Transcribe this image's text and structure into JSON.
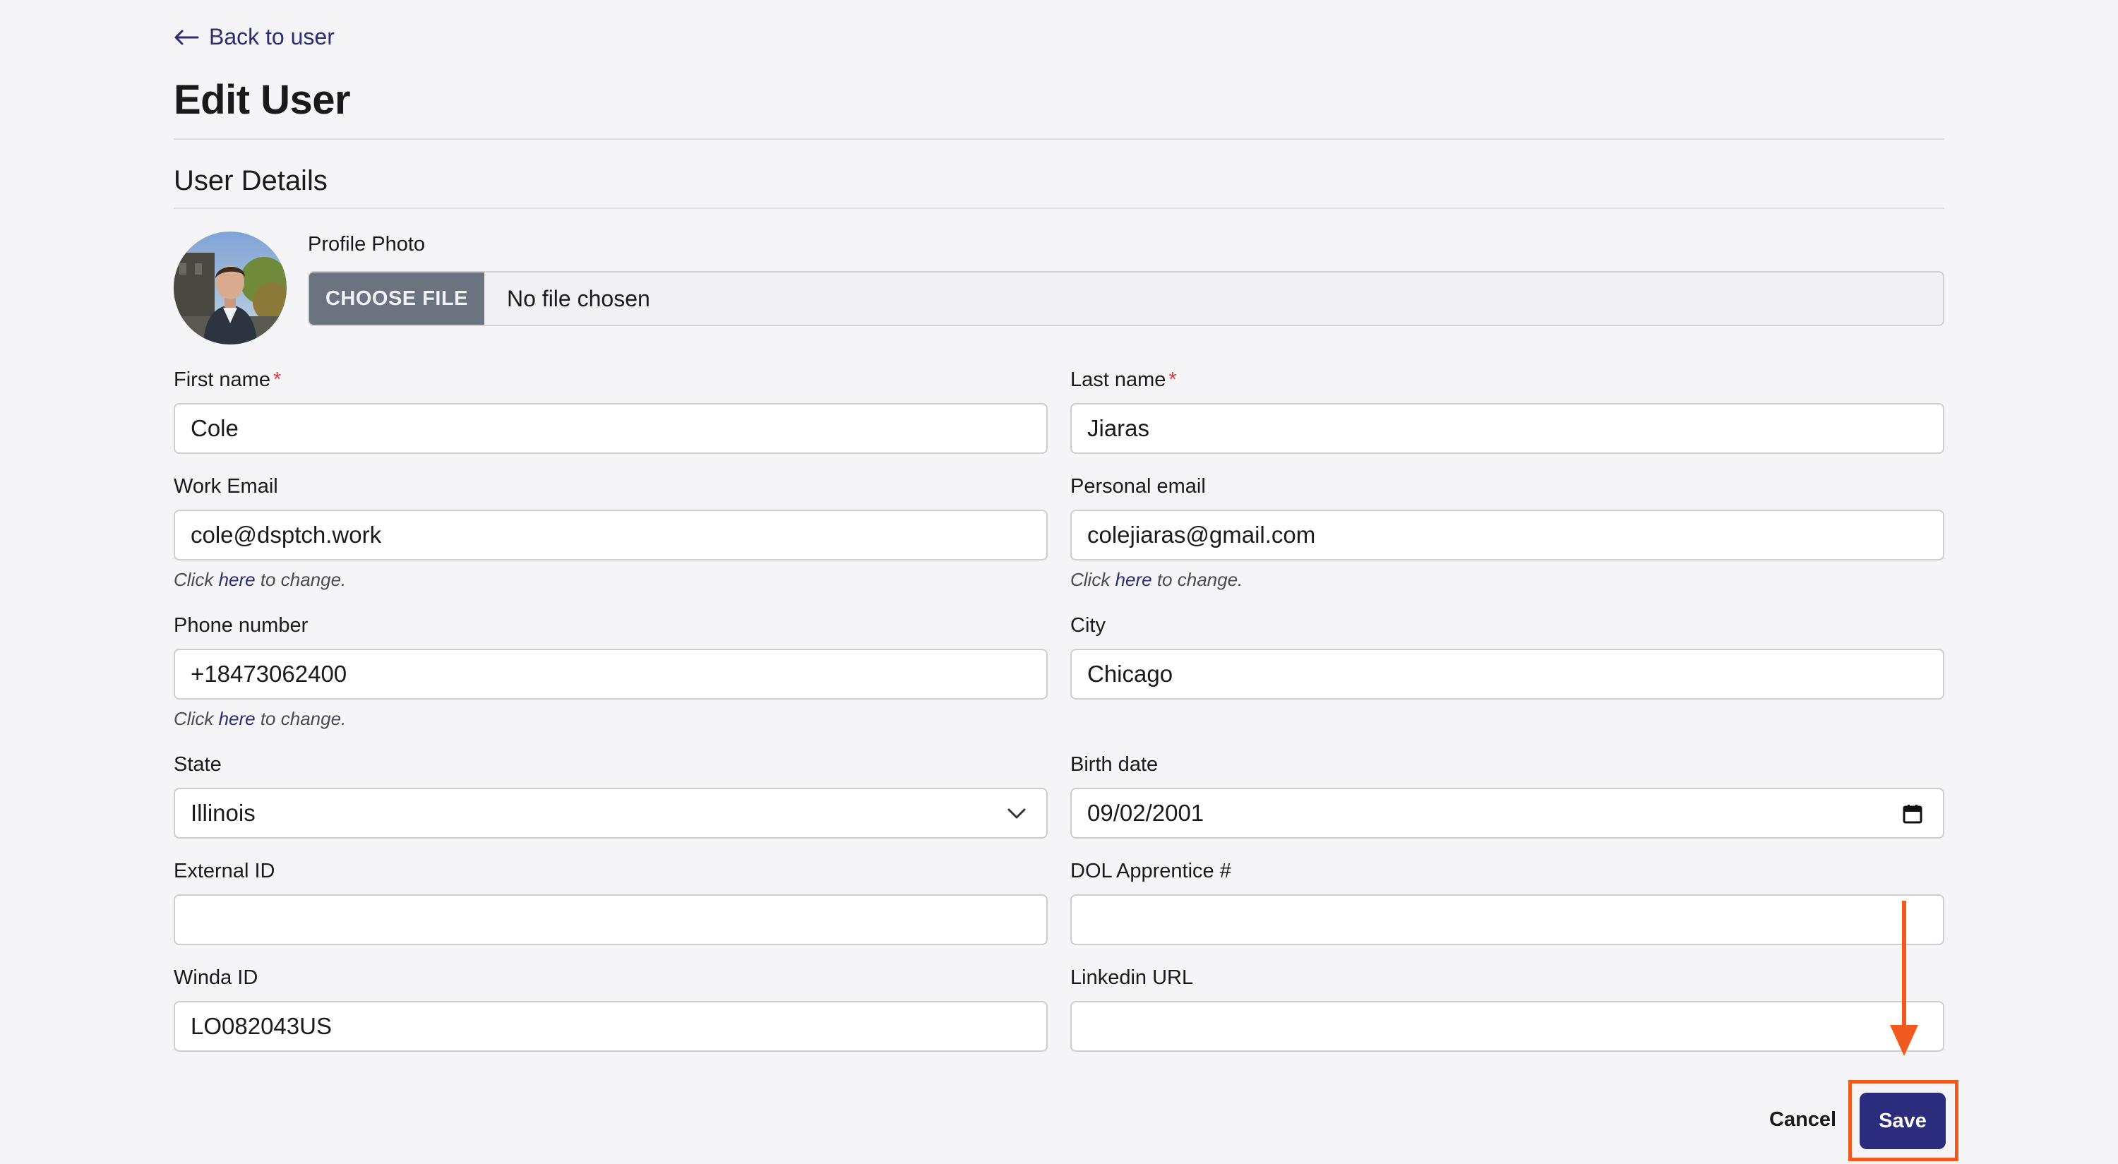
{
  "nav": {
    "back_label": "Back to user"
  },
  "page": {
    "title": "Edit User",
    "section_title": "User Details"
  },
  "profile_photo": {
    "label": "Profile Photo",
    "choose_button": "CHOOSE FILE",
    "status": "No file chosen"
  },
  "fields": {
    "first_name": {
      "label": "First name",
      "required_mark": "*",
      "value": "Cole"
    },
    "last_name": {
      "label": "Last name",
      "required_mark": "*",
      "value": "Jiaras"
    },
    "work_email": {
      "label": "Work Email",
      "value": "cole@dsptch.work"
    },
    "personal_email": {
      "label": "Personal email",
      "value": "colejiaras@gmail.com"
    },
    "phone": {
      "label": "Phone number",
      "value": "+18473062400"
    },
    "city": {
      "label": "City",
      "value": "Chicago"
    },
    "state": {
      "label": "State",
      "value": "Illinois"
    },
    "birth_date": {
      "label": "Birth date",
      "value": "09/02/2001"
    },
    "external_id": {
      "label": "External ID",
      "value": ""
    },
    "dol_apprentice": {
      "label": "DOL Apprentice #",
      "value": ""
    },
    "winda_id": {
      "label": "Winda ID",
      "value": "LO082043US"
    },
    "linkedin_url": {
      "label": "Linkedin URL",
      "value": ""
    }
  },
  "hint": {
    "prefix": "Click ",
    "link": "here",
    "suffix": " to change."
  },
  "actions": {
    "cancel_label": "Cancel",
    "save_label": "Save"
  },
  "colors": {
    "accent": "#2b2d7c",
    "highlight": "#f05a1e",
    "required": "#e0393e",
    "file_button": "#6b7280"
  },
  "icons": [
    "arrow-left-icon",
    "chevron-down-icon",
    "calendar-icon",
    "annotation-arrow-icon"
  ]
}
